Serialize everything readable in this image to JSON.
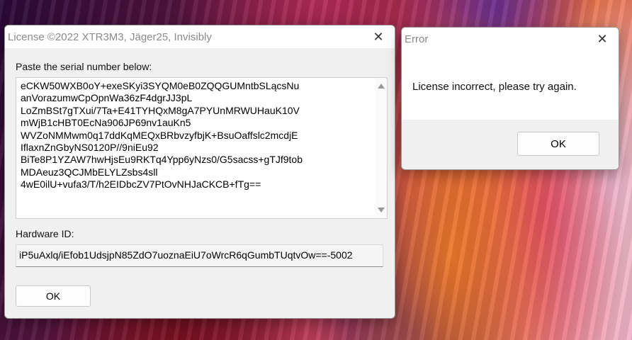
{
  "license_window": {
    "title": "License ©2022 XTR3M3, Jäger25, Invisibly",
    "close_glyph": "✕",
    "serial_label": "Paste the serial number below:",
    "serial_lines": [
      "eCKW50WXB0oY+exeSKyi3SYQM0eB0ZQQGUMntbSLącsNu",
      "anVorazumwCpOpnWa36zF4dgrJJ3pL",
      "LoZmBSt7gTXui/7Ta+E41TYHQxM8gA7PYUnMRWUHauK10V",
      "mWjB1cHBT0EcNa906JP69nv1auKn5",
      "WVZoNMMwm0q17ddKqMEQxBRbvzyfbjK+BsuOaffslc2mcdjE",
      "IflaxnZnGbyNS0120P//9niEu92",
      "BiTe8P1YZAW7hwHjsEu9RKTq4Ypp6yNzs0/G5sacss+gTJf9tob",
      "MDAeuz3QCJMbELYLZsbs4sll",
      "4wE0ilU+vufa3/T/h2EIDbcZV7PtOvNHJaCKCB+fTg=="
    ],
    "hardware_label": "Hardware ID:",
    "hardware_id": "iP5uAxlq/iEfob1UdsjpN85ZdO7uoznaEiU7oWrcR6qGumbTUqtvOw==-5002",
    "ok_label": "OK"
  },
  "error_window": {
    "title": "Error",
    "close_glyph": "✕",
    "message": "License incorrect, please try again.",
    "ok_label": "OK"
  }
}
